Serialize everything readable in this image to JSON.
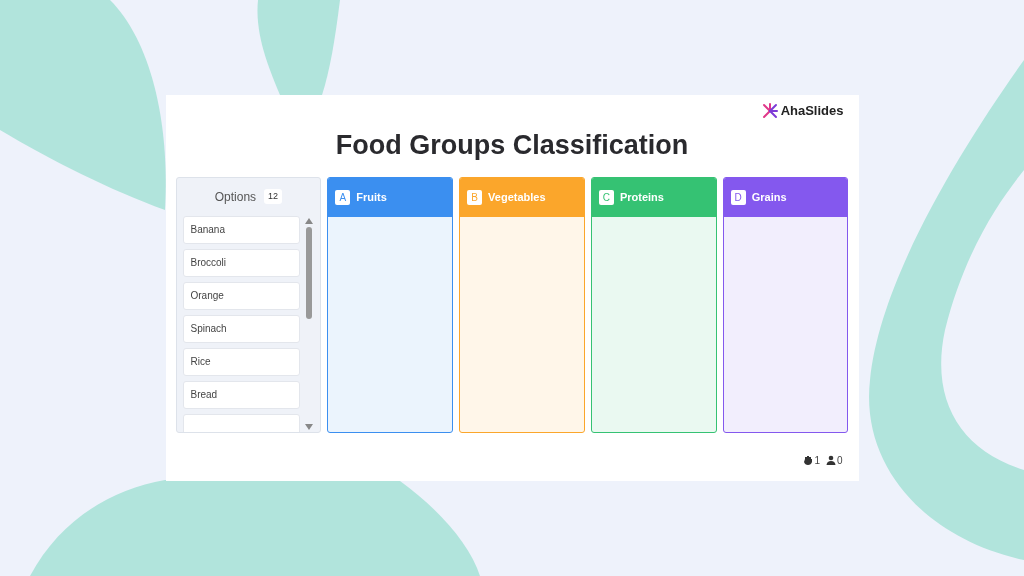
{
  "logo": {
    "text": "AhaSlides"
  },
  "title": "Food Groups Classification",
  "options": {
    "label": "Options",
    "count": "12",
    "items": [
      "Banana",
      "Broccoli",
      "Orange",
      "Spinach",
      "Rice",
      "Bread"
    ]
  },
  "categories": [
    {
      "letter": "A",
      "name": "Fruits",
      "color": "#3b8ff0"
    },
    {
      "letter": "B",
      "name": "Vegetables",
      "color": "#fba62b"
    },
    {
      "letter": "C",
      "name": "Proteins",
      "color": "#35c273"
    },
    {
      "letter": "D",
      "name": "Grains",
      "color": "#8458ee"
    }
  ],
  "footer": {
    "reactions": "1",
    "participants": "0"
  }
}
